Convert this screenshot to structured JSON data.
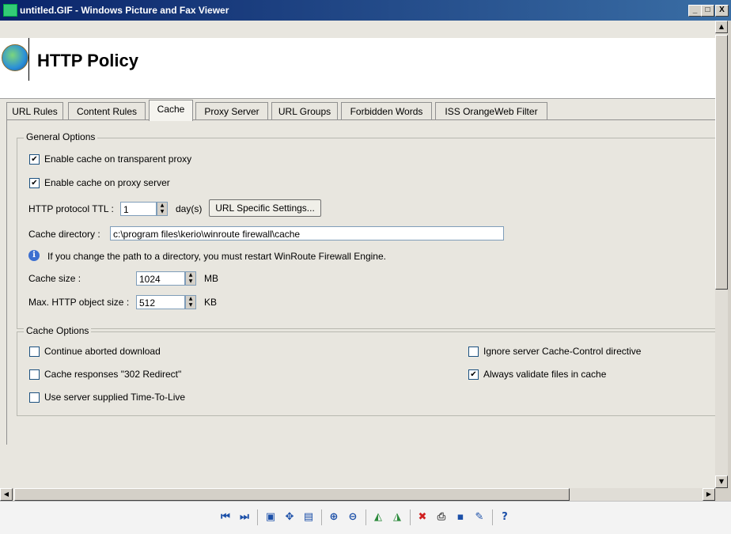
{
  "window": {
    "title": "untitled.GIF - Windows Picture and Fax Viewer",
    "minimize": "_",
    "maximize": "□",
    "close": "X"
  },
  "header": {
    "title": "HTTP Policy"
  },
  "tabs": [
    {
      "label": "URL Rules"
    },
    {
      "label": "Content Rules"
    },
    {
      "label": "Cache"
    },
    {
      "label": "Proxy Server"
    },
    {
      "label": "URL Groups"
    },
    {
      "label": "Forbidden Words"
    },
    {
      "label": "ISS OrangeWeb Filter"
    }
  ],
  "general_options": {
    "legend": "General Options",
    "enable_transparent": {
      "label": "Enable cache on transparent proxy",
      "checked": true
    },
    "enable_proxy": {
      "label": "Enable cache on proxy server",
      "checked": true
    },
    "ttl_label": "HTTP protocol TTL :",
    "ttl_value": "1",
    "ttl_unit": "day(s)",
    "url_specific_button": "URL Specific Settings...",
    "cache_dir_label": "Cache directory :",
    "cache_dir_value": "c:\\program files\\kerio\\winroute firewall\\cache",
    "info_text": "If you change the path to a directory, you must restart WinRoute Firewall Engine.",
    "cache_size_label": "Cache size :",
    "cache_size_value": "1024",
    "cache_size_unit": "MB",
    "max_object_label": "Max. HTTP object size :",
    "max_object_value": "512",
    "max_object_unit": "KB"
  },
  "cache_options": {
    "legend": "Cache Options",
    "continue_aborted": {
      "label": "Continue aborted download",
      "checked": false
    },
    "cache_302": {
      "label": "Cache responses \"302 Redirect\"",
      "checked": false
    },
    "use_server_ttl": {
      "label": "Use server supplied Time-To-Live",
      "checked": false
    },
    "ignore_cache_control": {
      "label": "Ignore server Cache-Control directive",
      "checked": false
    },
    "always_validate": {
      "label": "Always validate files in cache",
      "checked": true
    }
  },
  "checkmark": "✔",
  "viewer_toolbar": {
    "icons": [
      "previous-image-icon",
      "next-image-icon",
      "best-fit-icon",
      "actual-size-icon",
      "slideshow-icon",
      "zoom-in-icon",
      "zoom-out-icon",
      "rotate-clockwise-icon",
      "rotate-counterclockwise-icon",
      "delete-icon",
      "print-icon",
      "save-icon",
      "edit-icon",
      "help-icon"
    ]
  }
}
